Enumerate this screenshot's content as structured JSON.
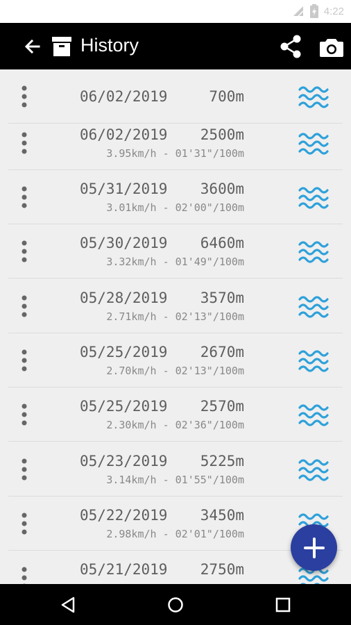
{
  "status_bar": {
    "time": "4:22",
    "icons": [
      "signal-off-icon",
      "battery-charging-icon"
    ]
  },
  "app_bar": {
    "title": "History",
    "icons": [
      "back-arrow-icon",
      "archive-icon",
      "share-icon",
      "camera-icon"
    ]
  },
  "sessions": [
    {
      "date": "06/02/2019",
      "distance": "700m",
      "stats": ""
    },
    {
      "date": "06/02/2019",
      "distance": "2500m",
      "stats": "3.95km/h - 01'31\"/100m"
    },
    {
      "date": "05/31/2019",
      "distance": "3600m",
      "stats": "3.01km/h - 02'00\"/100m"
    },
    {
      "date": "05/30/2019",
      "distance": "6460m",
      "stats": "3.32km/h - 01'49\"/100m"
    },
    {
      "date": "05/28/2019",
      "distance": "3570m",
      "stats": "2.71km/h - 02'13\"/100m"
    },
    {
      "date": "05/25/2019",
      "distance": "2670m",
      "stats": "2.70km/h - 02'13\"/100m"
    },
    {
      "date": "05/25/2019",
      "distance": "2570m",
      "stats": "2.30km/h - 02'36\"/100m"
    },
    {
      "date": "05/23/2019",
      "distance": "5225m",
      "stats": "3.14km/h - 01'55\"/100m"
    },
    {
      "date": "05/22/2019",
      "distance": "3450m",
      "stats": "2.98km/h - 02'01\"/100m"
    },
    {
      "date": "05/21/2019",
      "distance": "2750m",
      "stats": ""
    }
  ],
  "fab": {
    "icon": "plus-icon"
  },
  "colors": {
    "app_bar": "#000000",
    "wave_icon": "#2ea1da",
    "fab": "#2b3fa0",
    "list_background": "#efefef"
  },
  "nav_bar": {
    "icons": [
      "back-triangle-icon",
      "home-circle-icon",
      "recents-square-icon"
    ]
  }
}
